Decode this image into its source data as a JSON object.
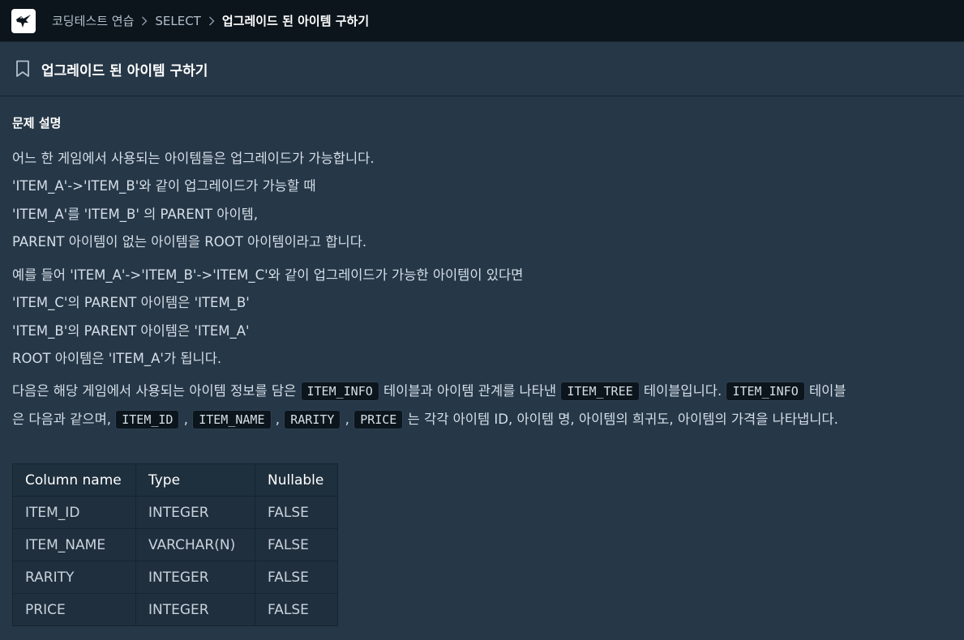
{
  "header": {
    "breadcrumb": [
      "코딩테스트 연습",
      "SELECT",
      "업그레이드 된 아이템 구하기"
    ]
  },
  "problem": {
    "title": "업그레이드 된 아이템 구하기",
    "section_heading": "문제 설명",
    "paragraph1": [
      "어느 한 게임에서 사용되는 아이템들은 업그레이드가 가능합니다.",
      "'ITEM_A'->'ITEM_B'와 같이 업그레이드가 가능할 때",
      "'ITEM_A'를 'ITEM_B' 의 PARENT 아이템,",
      "PARENT 아이템이 없는 아이템을 ROOT 아이템이라고 합니다."
    ],
    "paragraph2": [
      "예를 들어 'ITEM_A'->'ITEM_B'->'ITEM_C'와 같이 업그레이드가 가능한 아이템이 있다면",
      "'ITEM_C'의 PARENT 아이템은 'ITEM_B'",
      "'ITEM_B'의 PARENT 아이템은 'ITEM_A'",
      "ROOT 아이템은 'ITEM_A'가 됩니다."
    ],
    "paragraph3": {
      "t1": "다음은 해당 게임에서 사용되는 아이템 정보를 담은 ",
      "c1": "ITEM_INFO",
      "t2": " 테이블과 아이템 관계를 나타낸 ",
      "c2": "ITEM_TREE",
      "t3": " 테이블입니다. ",
      "c3": "ITEM_INFO",
      "t4": " 테이블",
      "t5": "은 다음과 같으며, ",
      "c4": "ITEM_ID",
      "s1": " , ",
      "c5": "ITEM_NAME",
      "s2": " , ",
      "c6": "RARITY",
      "s3": " , ",
      "c7": "PRICE",
      "t6": " 는 각각 아이템 ID, 아이템 명, 아이템의 희귀도, 아이템의 가격을 나타냅니다."
    },
    "table": {
      "headers": [
        "Column name",
        "Type",
        "Nullable"
      ],
      "rows": [
        [
          "ITEM_ID",
          "INTEGER",
          "FALSE"
        ],
        [
          "ITEM_NAME",
          "VARCHAR(N)",
          "FALSE"
        ],
        [
          "RARITY",
          "INTEGER",
          "FALSE"
        ],
        [
          "PRICE",
          "INTEGER",
          "FALSE"
        ]
      ]
    }
  },
  "icons": {
    "logo": "programmers-bird-logo",
    "separator": "chevron-right-icon",
    "bookmark": "bookmark-icon"
  },
  "colors": {
    "header_bg": "#0c151c",
    "page_bg": "#263747",
    "code_bg": "#0c151c",
    "table_header_bg": "#1e2f3d",
    "table_cell_bg": "#202f3e"
  }
}
